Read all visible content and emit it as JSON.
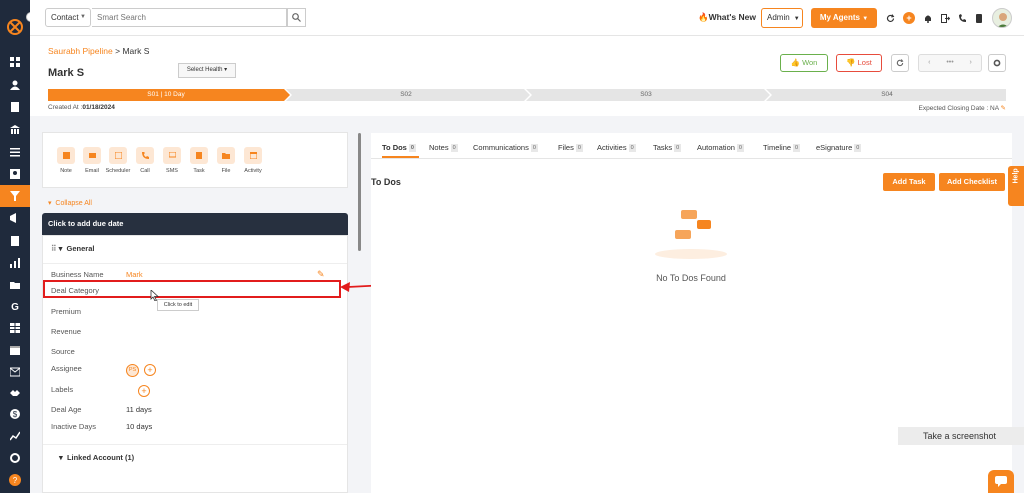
{
  "topbar": {
    "contact_select": "Contact",
    "search_placeholder": "Smart Search",
    "whats_new": "What's New",
    "admin_select": "Admin",
    "my_agents": "My Agents"
  },
  "header": {
    "breadcrumb_pipeline": "Saurabh Pipeline",
    "breadcrumb_sep": " > ",
    "breadcrumb_deal": "Mark S",
    "title": "Mark S",
    "select_health": "Select Health",
    "won": "Won",
    "lost": "Lost",
    "pager_dots": "•••",
    "stages": [
      "S01 | 10 Day",
      "S02",
      "S03",
      "S04"
    ],
    "created_at_label": "Created At :",
    "created_at_value": "01/18/2024",
    "closing_date": "Expected Closing Date : NA"
  },
  "actions": [
    {
      "label": "Note",
      "icon": "note-icon"
    },
    {
      "label": "Email",
      "icon": "email-icon"
    },
    {
      "label": "Scheduler",
      "icon": "scheduler-icon"
    },
    {
      "label": "Call",
      "icon": "phone-icon"
    },
    {
      "label": "SMS",
      "icon": "sms-icon"
    },
    {
      "label": "Task",
      "icon": "task-icon"
    },
    {
      "label": "File",
      "icon": "folder-icon"
    },
    {
      "label": "Activity",
      "icon": "calendar-icon"
    }
  ],
  "left": {
    "collapse_all": "Collapse All",
    "due_date": "Click to add due date",
    "general": "General",
    "fields": [
      {
        "label": "Business Name",
        "value": "Mark"
      },
      {
        "label": "Deal Category",
        "value": ""
      },
      {
        "label": "Premium",
        "value": ""
      },
      {
        "label": "Revenue",
        "value": ""
      },
      {
        "label": "Source",
        "value": ""
      },
      {
        "label": "Assignee",
        "value": "PS"
      },
      {
        "label": "Labels",
        "value": ""
      },
      {
        "label": "Deal Age",
        "value": "11 days"
      },
      {
        "label": "Inactive Days",
        "value": "10 days"
      }
    ],
    "tooltip": "Click to edit",
    "linked_account": "Linked Account (1)"
  },
  "tabs": [
    {
      "label": "To Dos",
      "count": "0"
    },
    {
      "label": "Notes",
      "count": "0"
    },
    {
      "label": "Communications",
      "count": "0"
    },
    {
      "label": "Files",
      "count": "0"
    },
    {
      "label": "Activities",
      "count": "0"
    },
    {
      "label": "Tasks",
      "count": "0"
    },
    {
      "label": "Automation",
      "count": "0"
    },
    {
      "label": "Timeline",
      "count": "0"
    },
    {
      "label": "eSignature",
      "count": "0"
    }
  ],
  "todos": {
    "title": "To Dos",
    "add_task": "Add Task",
    "add_checklist": "Add Checklist",
    "empty": "No To Dos Found"
  },
  "help": "Help",
  "screenshot_tip": "Take a screenshot",
  "colors": {
    "accent": "#f6851f",
    "sidebar": "#1f2a3c",
    "won": "#6ab04c",
    "lost": "#e74c3c",
    "highlight": "#e21c1c"
  }
}
